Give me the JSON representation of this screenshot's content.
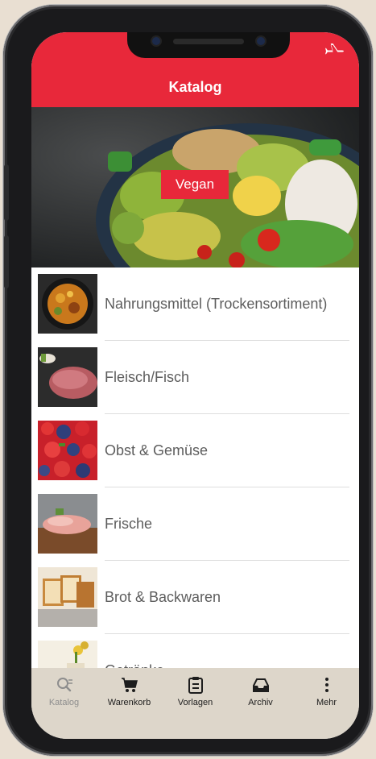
{
  "header": {
    "title": "Katalog",
    "right_icon": "airplane-icon"
  },
  "hero": {
    "button_label": "Vegan",
    "image": "salad-bowl-photo"
  },
  "categories": [
    {
      "label": "Nahrungsmittel (Trockensortiment)",
      "image": "dry-food-bowl-photo"
    },
    {
      "label": "Fleisch/Fisch",
      "image": "raw-meat-photo"
    },
    {
      "label": "Obst & Gemüse",
      "image": "berries-photo"
    },
    {
      "label": "Frische",
      "image": "charcuterie-photo"
    },
    {
      "label": "Brot & Backwaren",
      "image": "bread-photo"
    },
    {
      "label": "Getränke",
      "image": "drinks-photo"
    }
  ],
  "tabs": [
    {
      "label": "Katalog",
      "icon": "catalog-search-icon",
      "active": true
    },
    {
      "label": "Warenkorb",
      "icon": "cart-icon",
      "active": false
    },
    {
      "label": "Vorlagen",
      "icon": "clipboard-icon",
      "active": false
    },
    {
      "label": "Archiv",
      "icon": "archive-tray-icon",
      "active": false
    },
    {
      "label": "Mehr",
      "icon": "more-vertical-icon",
      "active": false
    }
  ],
  "colors": {
    "accent": "#e8283a",
    "tab_bar": "#ddd6ca",
    "background": "#e9dfd2"
  }
}
